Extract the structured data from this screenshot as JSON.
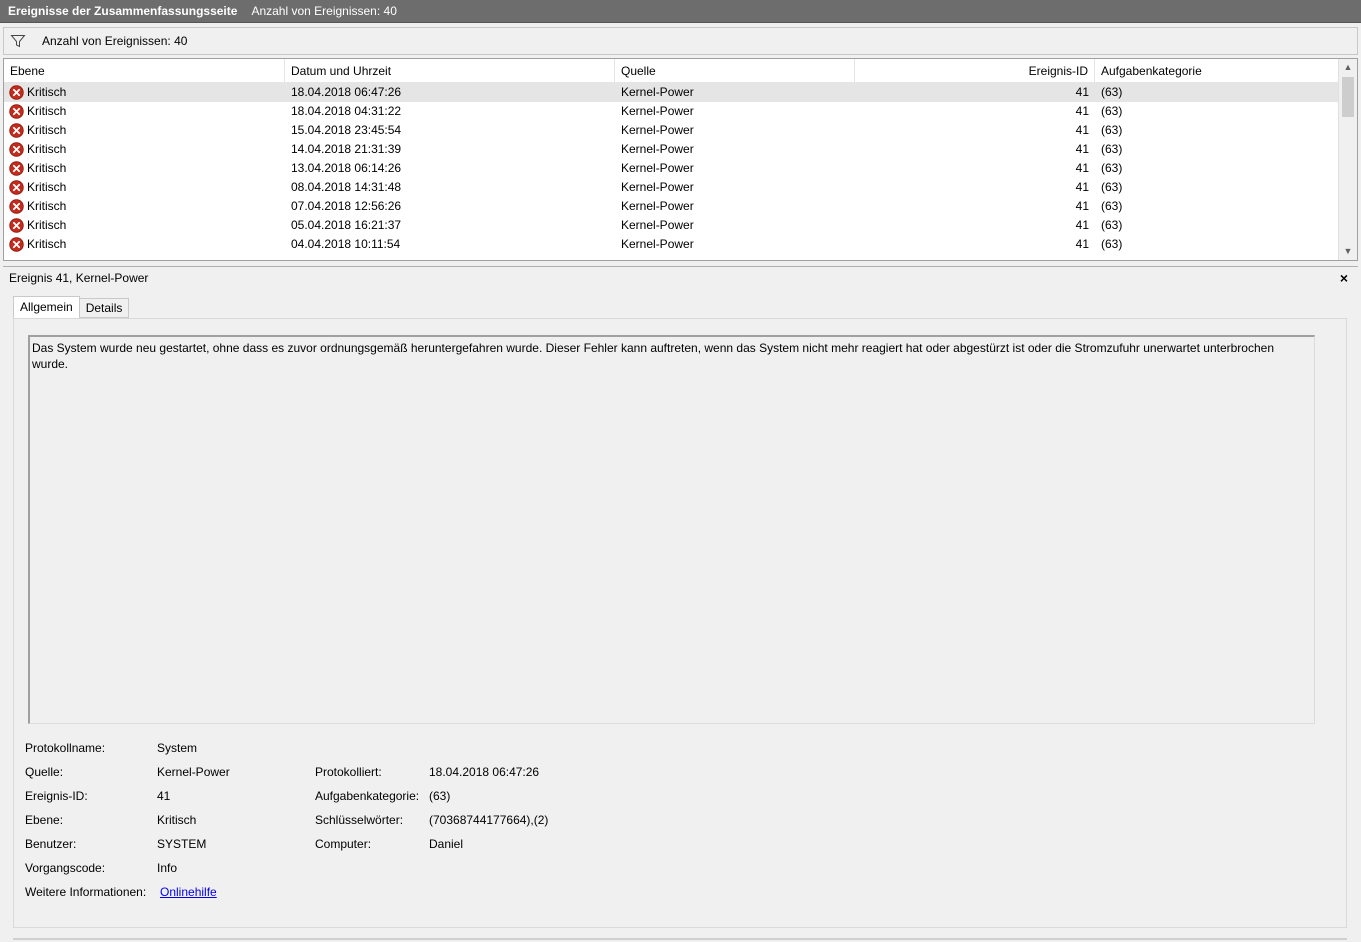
{
  "titlebar": {
    "title": "Ereignisse der Zusammenfassungsseite",
    "count": "Anzahl von Ereignissen: 40"
  },
  "filterbar": {
    "icon": "filter-icon",
    "count": "Anzahl von Ereignissen: 40"
  },
  "list": {
    "headers": {
      "level": "Ebene",
      "date": "Datum und Uhrzeit",
      "source": "Quelle",
      "id": "Ereignis-ID",
      "category": "Aufgabenkategorie"
    },
    "rows": [
      {
        "level": "Kritisch",
        "date": "18.04.2018 06:47:26",
        "source": "Kernel-Power",
        "id": "41",
        "category": "(63)"
      },
      {
        "level": "Kritisch",
        "date": "18.04.2018 04:31:22",
        "source": "Kernel-Power",
        "id": "41",
        "category": "(63)"
      },
      {
        "level": "Kritisch",
        "date": "15.04.2018 23:45:54",
        "source": "Kernel-Power",
        "id": "41",
        "category": "(63)"
      },
      {
        "level": "Kritisch",
        "date": "14.04.2018 21:31:39",
        "source": "Kernel-Power",
        "id": "41",
        "category": "(63)"
      },
      {
        "level": "Kritisch",
        "date": "13.04.2018 06:14:26",
        "source": "Kernel-Power",
        "id": "41",
        "category": "(63)"
      },
      {
        "level": "Kritisch",
        "date": "08.04.2018 14:31:48",
        "source": "Kernel-Power",
        "id": "41",
        "category": "(63)"
      },
      {
        "level": "Kritisch",
        "date": "07.04.2018 12:56:26",
        "source": "Kernel-Power",
        "id": "41",
        "category": "(63)"
      },
      {
        "level": "Kritisch",
        "date": "05.04.2018 16:21:37",
        "source": "Kernel-Power",
        "id": "41",
        "category": "(63)"
      },
      {
        "level": "Kritisch",
        "date": "04.04.2018 10:11:54",
        "source": "Kernel-Power",
        "id": "41",
        "category": "(63)"
      }
    ]
  },
  "detail": {
    "title": "Ereignis 41, Kernel-Power",
    "close": "×",
    "tabs": [
      "Allgemein",
      "Details"
    ],
    "description": "Das System wurde neu gestartet, ohne dass es zuvor ordnungsgemäß heruntergefahren wurde. Dieser Fehler kann auftreten, wenn das System nicht mehr reagiert hat oder abgestürzt ist oder die Stromzufuhr unerwartet unterbrochen wurde.",
    "props": {
      "log_name_label": "Protokollname:",
      "log_name": "System",
      "source_label": "Quelle:",
      "source": "Kernel-Power",
      "logged_label": "Protokolliert:",
      "logged": "18.04.2018 06:47:26",
      "event_id_label": "Ereignis-ID:",
      "event_id": "41",
      "task_category_label": "Aufgabenkategorie:",
      "task_category": "(63)",
      "level_label": "Ebene:",
      "level": "Kritisch",
      "keywords_label": "Schlüsselwörter:",
      "keywords": "(70368744177664),(2)",
      "user_label": "Benutzer:",
      "user": "SYSTEM",
      "computer_label": "Computer:",
      "computer": "Daniel",
      "opcode_label": "Vorgangscode:",
      "opcode": "Info",
      "more_info_label": "Weitere Informationen:",
      "more_info_link": "Onlinehilfe"
    }
  },
  "colors": {
    "titlebar": "#6d6d6d",
    "critical": "#c42b1c",
    "selected_row": "#e5e5e5",
    "link": "#0000ee"
  }
}
